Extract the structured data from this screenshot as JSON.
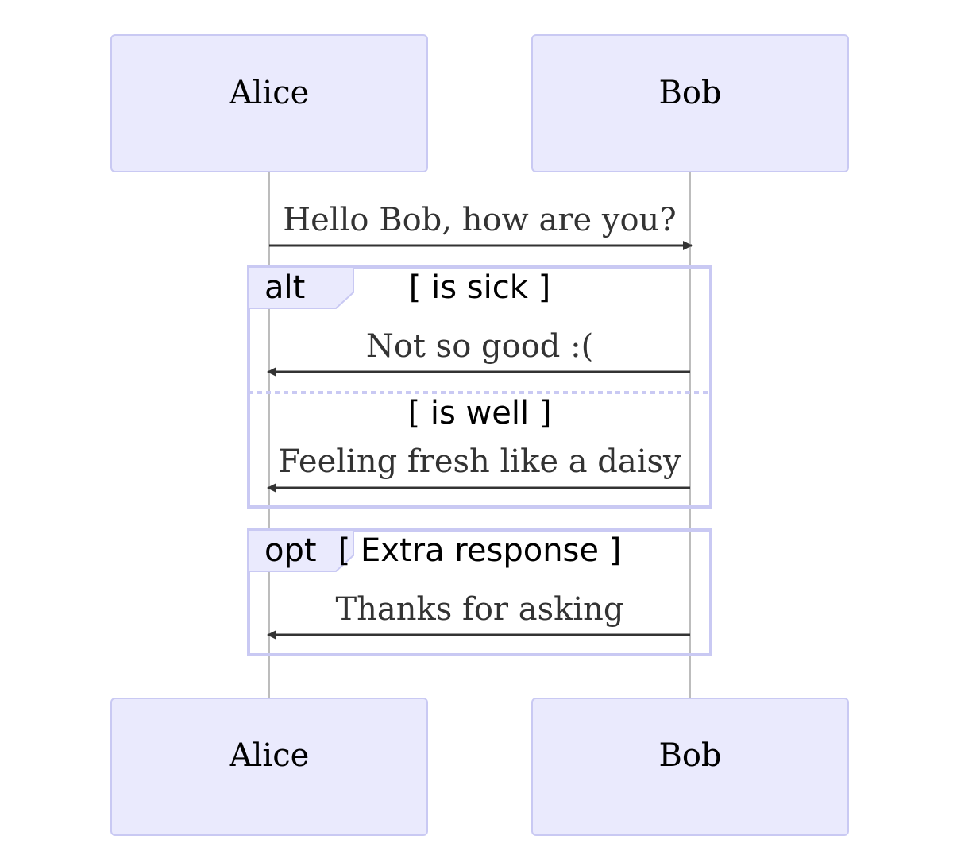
{
  "actors": {
    "alice": "Alice",
    "bob": "Bob"
  },
  "messages": [
    {
      "from": "Alice",
      "to": "Bob",
      "text": "Hello Bob, how are you?"
    },
    {
      "from": "Bob",
      "to": "Alice",
      "text": "Not so good :("
    },
    {
      "from": "Bob",
      "to": "Alice",
      "text": "Feeling fresh like a daisy"
    },
    {
      "from": "Bob",
      "to": "Alice",
      "text": "Thanks for asking"
    }
  ],
  "fragments": {
    "alt": {
      "keyword": "alt",
      "condition": "[ is sick ]",
      "else_condition": "[ is well ]"
    },
    "opt": {
      "keyword": "opt",
      "condition": "[ Extra response ]"
    }
  },
  "colors": {
    "actor_fill": "#eaeafd",
    "actor_stroke": "#c9c9f3",
    "message": "#333333",
    "lifeline": "#999999"
  }
}
